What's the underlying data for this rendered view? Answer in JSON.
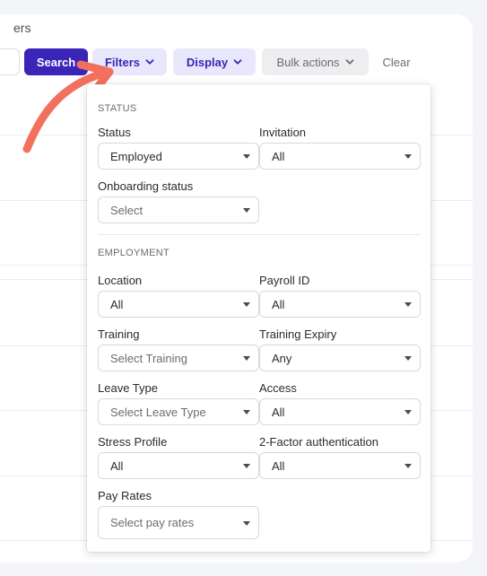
{
  "page": {
    "title_fragment": "ers"
  },
  "toolbar": {
    "search_label": "Search",
    "filters_label": "Filters",
    "display_label": "Display",
    "bulk_label": "Bulk actions",
    "clear_label": "Clear"
  },
  "filters": {
    "status_section": "STATUS",
    "employment_section": "EMPLOYMENT",
    "fields": {
      "status": {
        "label": "Status",
        "value": "Employed"
      },
      "invitation": {
        "label": "Invitation",
        "value": "All"
      },
      "onboarding": {
        "label": "Onboarding status",
        "value": "Select"
      },
      "location": {
        "label": "Location",
        "value": "All"
      },
      "payroll": {
        "label": "Payroll ID",
        "value": "All"
      },
      "training": {
        "label": "Training",
        "value": "Select Training"
      },
      "training_expiry": {
        "label": "Training Expiry",
        "value": "Any"
      },
      "leave_type": {
        "label": "Leave Type",
        "value": "Select Leave Type"
      },
      "access": {
        "label": "Access",
        "value": "All"
      },
      "stress": {
        "label": "Stress Profile",
        "value": "All"
      },
      "two_factor": {
        "label": "2-Factor authentication",
        "value": "All"
      },
      "pay_rates": {
        "label": "Pay Rates",
        "value": "Select pay rates"
      }
    }
  },
  "colors": {
    "primary": "#3a25b8",
    "primary_soft": "#e9e7fb",
    "annotation_arrow": "#f2705e"
  },
  "icons": {
    "filters_chevron": "chevron-down-icon",
    "display_chevron": "chevron-down-icon",
    "bulk_chevron": "chevron-down-icon",
    "annotation": "curved-arrow-icon"
  }
}
